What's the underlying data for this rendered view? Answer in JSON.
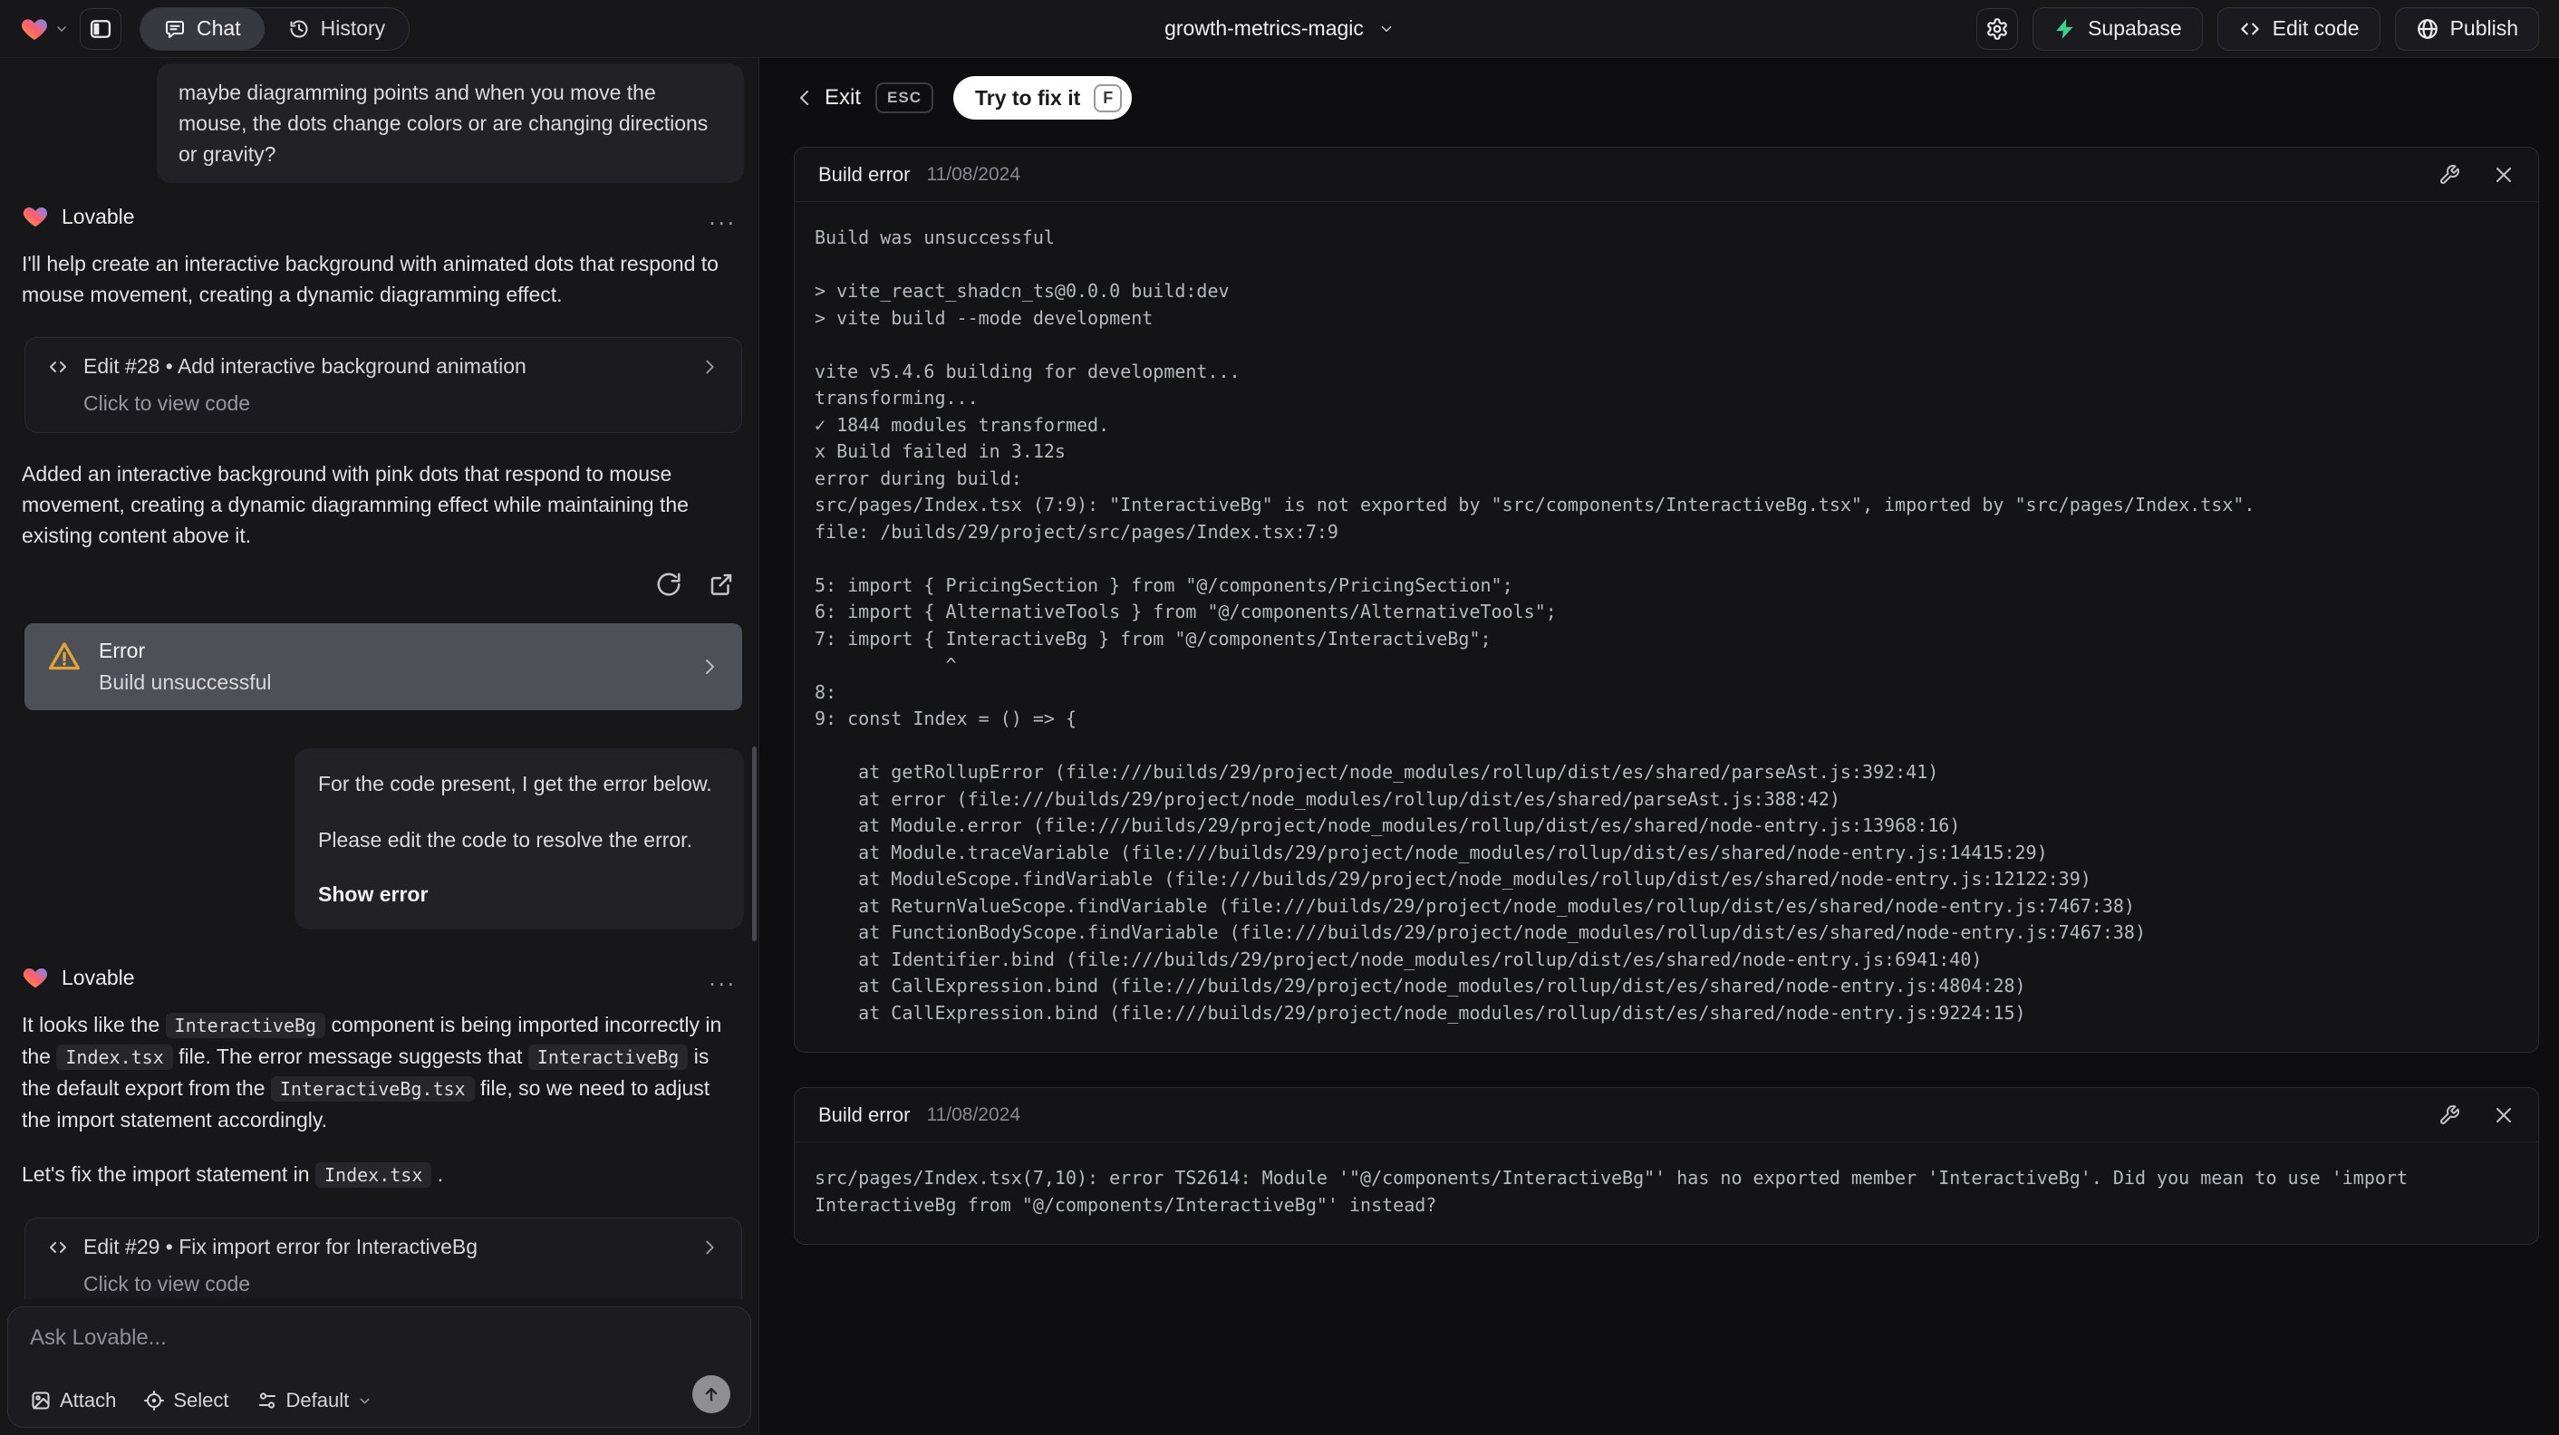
{
  "topbar": {
    "project_name": "growth-metrics-magic",
    "tabs": {
      "chat": "Chat",
      "history": "History"
    },
    "supabase_label": "Supabase",
    "edit_code_label": "Edit code",
    "publish_label": "Publish"
  },
  "chat": {
    "assistant_name": "Lovable",
    "user_message_1": "maybe diagramming points and when you move the mouse, the dots change colors or are changing directions or gravity?",
    "assistant_message_1": "I'll help create an interactive background with animated dots that respond to mouse movement, creating a dynamic diagramming effect.",
    "edit_card_1": {
      "title": "Edit #28 • Add interactive background animation",
      "subtitle": "Click to view code"
    },
    "assistant_message_2": "Added an interactive background with pink dots that respond to mouse movement, creating a dynamic diagramming effect while maintaining the existing content above it.",
    "error_card": {
      "title": "Error",
      "subtitle": "Build unsuccessful"
    },
    "user_message_2": {
      "line1": "For the code present, I get the error below.",
      "line2": "Please edit the code to resolve the error.",
      "action": "Show error"
    },
    "assistant_message_3": {
      "t1": "It looks like the ",
      "c1": "InteractiveBg",
      "t2": " component is being imported incorrectly in the ",
      "c2": "Index.tsx",
      "t3": " file. The error message suggests that ",
      "c3": "InteractiveBg",
      "t4": " is the default export from the ",
      "c4": "InteractiveBg.tsx",
      "t5": " file, so we need to adjust the import statement accordingly."
    },
    "assistant_message_4": {
      "t1": "Let's fix the import statement in ",
      "c1": "Index.tsx",
      "t2": " ."
    },
    "edit_card_2": {
      "title": "Edit #29 • Fix import error for InteractiveBg",
      "subtitle": "Click to view code"
    },
    "input": {
      "placeholder": "Ask Lovable...",
      "attach_label": "Attach",
      "select_label": "Select",
      "mode_label": "Default"
    }
  },
  "preview": {
    "exit_label": "Exit",
    "esc_badge": "ESC",
    "fix_button_label": "Try to fix it",
    "fix_key": "F",
    "cards": [
      {
        "title": "Build error",
        "date": "11/08/2024",
        "log": "Build was unsuccessful\n\n> vite_react_shadcn_ts@0.0.0 build:dev\n> vite build --mode development\n\nvite v5.4.6 building for development...\ntransforming...\n✓ 1844 modules transformed.\nx Build failed in 3.12s\nerror during build:\nsrc/pages/Index.tsx (7:9): \"InteractiveBg\" is not exported by \"src/components/InteractiveBg.tsx\", imported by \"src/pages/Index.tsx\".\nfile: /builds/29/project/src/pages/Index.tsx:7:9\n\n5: import { PricingSection } from \"@/components/PricingSection\";\n6: import { AlternativeTools } from \"@/components/AlternativeTools\";\n7: import { InteractiveBg } from \"@/components/InteractiveBg\";\n            ^\n8:\n9: const Index = () => {\n\n    at getRollupError (file:///builds/29/project/node_modules/rollup/dist/es/shared/parseAst.js:392:41)\n    at error (file:///builds/29/project/node_modules/rollup/dist/es/shared/parseAst.js:388:42)\n    at Module.error (file:///builds/29/project/node_modules/rollup/dist/es/shared/node-entry.js:13968:16)\n    at Module.traceVariable (file:///builds/29/project/node_modules/rollup/dist/es/shared/node-entry.js:14415:29)\n    at ModuleScope.findVariable (file:///builds/29/project/node_modules/rollup/dist/es/shared/node-entry.js:12122:39)\n    at ReturnValueScope.findVariable (file:///builds/29/project/node_modules/rollup/dist/es/shared/node-entry.js:7467:38)\n    at FunctionBodyScope.findVariable (file:///builds/29/project/node_modules/rollup/dist/es/shared/node-entry.js:7467:38)\n    at Identifier.bind (file:///builds/29/project/node_modules/rollup/dist/es/shared/node-entry.js:6941:40)\n    at CallExpression.bind (file:///builds/29/project/node_modules/rollup/dist/es/shared/node-entry.js:4804:28)\n    at CallExpression.bind (file:///builds/29/project/node_modules/rollup/dist/es/shared/node-entry.js:9224:15)"
      },
      {
        "title": "Build error",
        "date": "11/08/2024",
        "log": "src/pages/Index.tsx(7,10): error TS2614: Module '\"@/components/InteractiveBg\"' has no exported member 'InteractiveBg'. Did you mean to use 'import InteractiveBg from \"@/components/InteractiveBg\"' instead?"
      }
    ]
  },
  "colors": {
    "supabase_green": "#3ecf8e",
    "warning_amber": "#e0a43a",
    "panel_bg": "#17171a",
    "preview_bg": "#0e0e10",
    "card_bg": "#141417",
    "selected_error_bg": "#4d5056",
    "brand_gradient": [
      "#ffa24a",
      "#ff5e69",
      "#6e8bff"
    ]
  }
}
